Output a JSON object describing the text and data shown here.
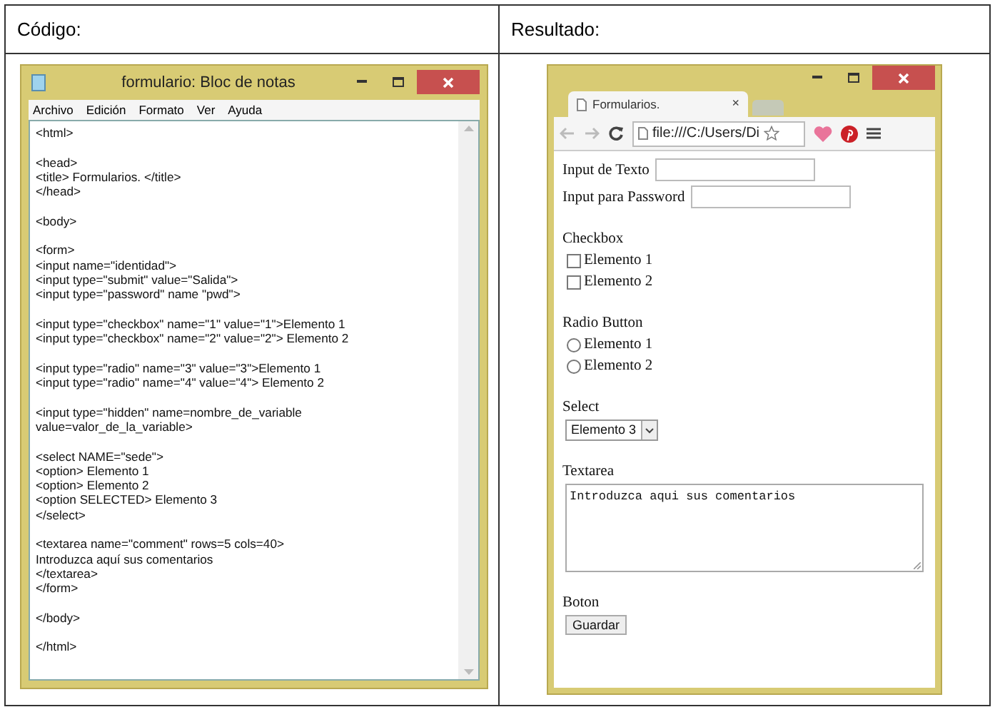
{
  "headers": [
    "Código:",
    "Resultado:"
  ],
  "notepad": {
    "title": "formulario: Bloc de notas",
    "menu": [
      "Archivo",
      "Edición",
      "Formato",
      "Ver",
      "Ayuda"
    ],
    "code": [
      [
        "<html>"
      ],
      [
        "<head>",
        "<title> Formularios. </title>",
        "</head>"
      ],
      [
        "<body>"
      ],
      [
        "<form>",
        "<input name=\"identidad\">",
        "<input type=\"submit\" value=\"Salida\">",
        "<input type=\"password\" name \"pwd\">"
      ],
      [
        "<input type=\"checkbox\" name=\"1\" value=\"1\">Elemento 1",
        "<input type=\"checkbox\" name=\"2\" value=\"2\"> Elemento 2"
      ],
      [
        "<input type=\"radio\" name=\"3\" value=\"3\">Elemento 1",
        "<input type=\"radio\" name=\"4\" value=\"4\"> Elemento 2"
      ],
      [
        "<input type=\"hidden\" name=nombre_de_variable",
        "value=valor_de_la_variable>"
      ],
      [
        "<select NAME=\"sede\">",
        "<option> Elemento 1",
        "<option> Elemento 2",
        "<option SELECTED> Elemento 3",
        "</select>"
      ],
      [
        "<textarea name=\"comment\" rows=5 cols=40>",
        "Introduzca aquí sus comentarios",
        "</textarea>",
        "</form>"
      ],
      [
        "</body>"
      ],
      [
        "</html>"
      ]
    ]
  },
  "browser": {
    "tab": {
      "title": "Formularios.",
      "close": "×"
    },
    "address": "file:///C:/Users/Di",
    "sections": [
      {
        "kind": "inputs",
        "items": [
          {
            "label": "Input de Texto"
          },
          {
            "label": "Input para Password"
          }
        ]
      },
      {
        "kind": "checkboxes",
        "title": "Checkbox",
        "items": [
          {
            "label": "Elemento 1",
            "checked": false
          },
          {
            "label": "Elemento 2",
            "checked": false
          }
        ]
      },
      {
        "kind": "radios",
        "title": "Radio Button",
        "items": [
          {
            "label": "Elemento 1",
            "selected": false
          },
          {
            "label": "Elemento 2",
            "selected": false
          }
        ]
      },
      {
        "kind": "select",
        "title": "Select",
        "value": "Elemento 3"
      },
      {
        "kind": "textarea",
        "title": "Textarea",
        "value": "Introduzca aqui sus comentarios"
      },
      {
        "kind": "button",
        "title": "Boton",
        "label": "Guardar"
      }
    ]
  }
}
